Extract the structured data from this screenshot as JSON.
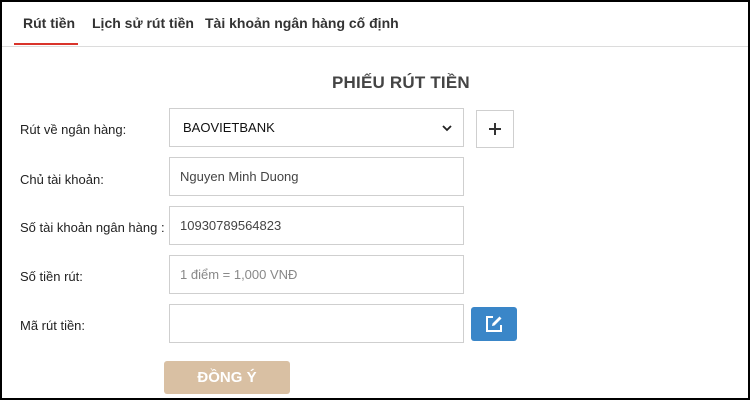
{
  "tabs": [
    {
      "label": "Rút tiền",
      "active": true
    },
    {
      "label": "Lịch sử rút tiền",
      "active": false
    },
    {
      "label": "Tài khoản ngân hàng cố định",
      "active": false
    }
  ],
  "accent_color": "#d9342b",
  "form": {
    "title": "PHIẾU RÚT TIỀN",
    "bank": {
      "label": "Rút về ngân hàng:",
      "selected": "BAOVIETBANK"
    },
    "account_holder": {
      "label": "Chủ tài khoản:",
      "value": "Nguyen Minh Duong"
    },
    "account_number": {
      "label": "Số tài khoản ngân hàng :",
      "value": "10930789564823"
    },
    "amount": {
      "label": "Số tiền rút:",
      "placeholder": "1 điểm = 1,000 VNĐ"
    },
    "withdraw_code": {
      "label": "Mã rút tiền:",
      "value": ""
    },
    "submit_label": "ĐỒNG Ý"
  },
  "icons": {
    "add": "plus-icon",
    "edit": "edit-icon",
    "dropdown": "chevron-down-icon"
  }
}
